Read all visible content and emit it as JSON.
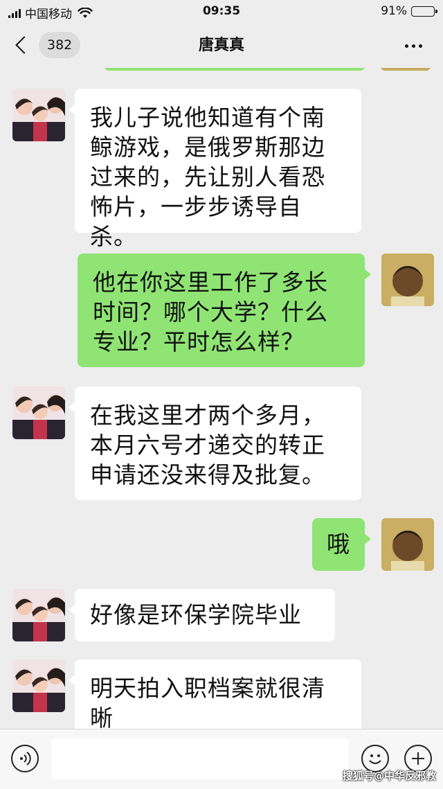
{
  "status_bar": {
    "carrier": "中国移动",
    "time": "09:35",
    "battery_text": "91%",
    "battery_level": 0.91
  },
  "nav": {
    "unread_count": "382",
    "title": "唐真真"
  },
  "messages": [
    {
      "from": "other",
      "text": "我儿子说他知道有个南鲸游戏，是俄罗斯那边过来的，先让别人看恐怖片，一步步诱导自杀。"
    },
    {
      "from": "me",
      "text": "他在你这里工作了多长时间？哪个大学？什么专业？平时怎么样？"
    },
    {
      "from": "other",
      "text": "在我这里才两个多月，本月六号才递交的转正申请还没来得及批复。"
    },
    {
      "from": "me",
      "text": "哦"
    },
    {
      "from": "other",
      "text": "好像是环保学院毕业"
    },
    {
      "from": "other",
      "text": "明天拍入职档案就很清晰"
    }
  ],
  "input": {
    "value": "",
    "placeholder": ""
  },
  "watermark": "搜狐号@中华反邪教",
  "colors": {
    "background": "#ededed",
    "incoming_bubble": "#ffffff",
    "outgoing_bubble": "#8fe474"
  }
}
